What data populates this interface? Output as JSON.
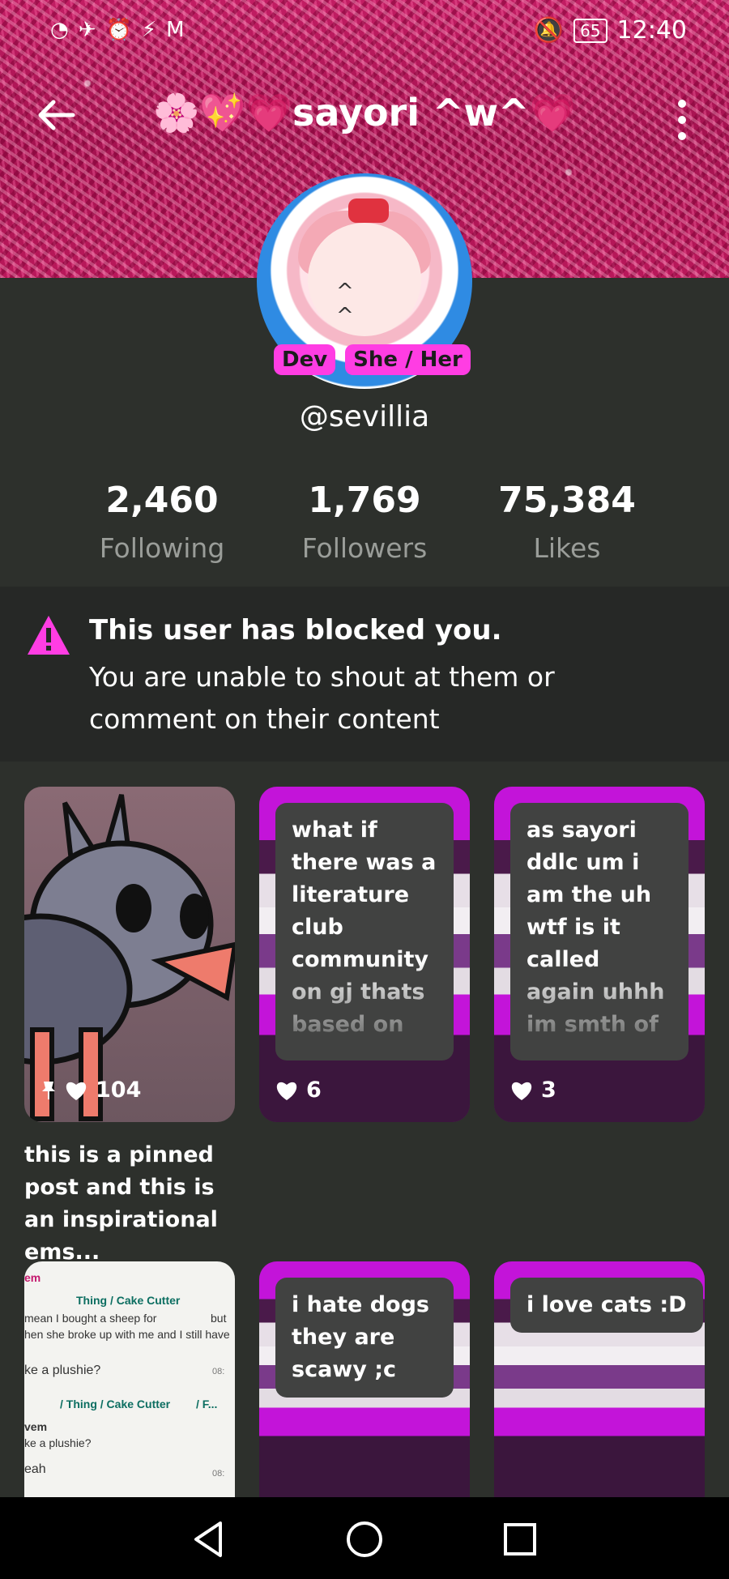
{
  "status_bar": {
    "left_icons": [
      "wifi-icon",
      "airplane-icon",
      "alarm-icon",
      "flash-icon",
      "gmail-icon"
    ],
    "battery": "65",
    "time": "12:40"
  },
  "header": {
    "title": "🌸💖💗sayori ^w^💗",
    "handle": "@sevillia",
    "badges": [
      "Dev",
      "She / Her"
    ]
  },
  "stats": [
    {
      "value": "2,460",
      "label": "Following"
    },
    {
      "value": "1,769",
      "label": "Followers"
    },
    {
      "value": "75,384",
      "label": "Likes"
    }
  ],
  "blocked": {
    "title": "This user has blocked you.",
    "body": "You are unable to shout at them or comment on their content"
  },
  "posts": [
    {
      "type": "image",
      "likes": "104",
      "pinned": true,
      "caption": "this is a pinned post and this is an inspirational ems..."
    },
    {
      "type": "text",
      "text": "what if there was a literature club community on gj thats based on",
      "likes": "6"
    },
    {
      "type": "text",
      "text": "as sayori ddlc um i am the uh wtf is it called again uhhh im smth of",
      "likes": "3"
    },
    {
      "type": "screenshot",
      "lines": [
        "em",
        "Thing / Cake Cutter",
        "mean I bought a sheep for",
        "but",
        "hen she broke up with me and I still have",
        "ke a plushie?",
        "08:",
        "/ Thing / Cake Cutter",
        "/ F...",
        "vem",
        "ke a plushie?",
        "eah",
        "08:"
      ]
    },
    {
      "type": "text",
      "text": "i hate dogs they are scawy ;c"
    },
    {
      "type": "text",
      "text": "i love cats :D"
    }
  ],
  "colors": {
    "accent": "#ff3de3",
    "background": "#2d302c",
    "blocked_bg": "#262826"
  }
}
